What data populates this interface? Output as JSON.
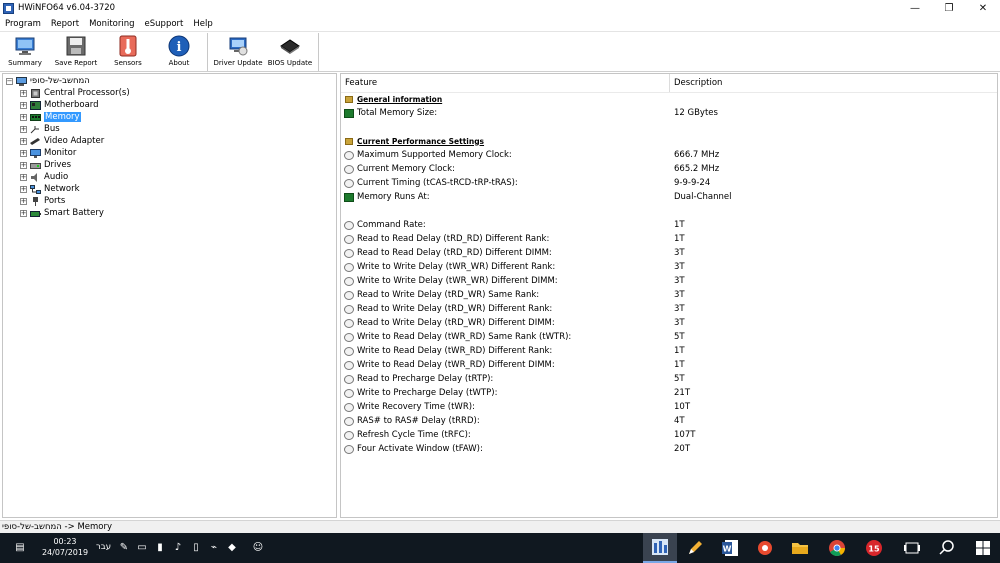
{
  "window": {
    "title": "HWiNFO64 v6.04-3720",
    "controls": [
      "—",
      "❐",
      "✕"
    ]
  },
  "menu": [
    "Program",
    "Report",
    "Monitoring",
    "eSupport",
    "Help"
  ],
  "toolbar": [
    {
      "label": "Summary",
      "icon": "monitor-icon"
    },
    {
      "label": "Save Report",
      "icon": "floppy-icon"
    },
    {
      "label": "Sensors",
      "icon": "thermometer-icon"
    },
    {
      "label": "About",
      "icon": "info-icon"
    },
    {
      "label": "Driver Update",
      "icon": "driver-update-icon"
    },
    {
      "label": "BIOS Update",
      "icon": "chip-icon"
    }
  ],
  "tree": {
    "root": "המחשב-של-סופי",
    "items": [
      {
        "label": "Central Processor(s)",
        "icon": "cpu-icon"
      },
      {
        "label": "Motherboard",
        "icon": "motherboard-icon"
      },
      {
        "label": "Memory",
        "icon": "memory-icon",
        "selected": true
      },
      {
        "label": "Bus",
        "icon": "bus-icon"
      },
      {
        "label": "Video Adapter",
        "icon": "video-adapter-icon"
      },
      {
        "label": "Monitor",
        "icon": "monitor-icon"
      },
      {
        "label": "Drives",
        "icon": "drive-icon"
      },
      {
        "label": "Audio",
        "icon": "audio-icon"
      },
      {
        "label": "Network",
        "icon": "network-icon"
      },
      {
        "label": "Ports",
        "icon": "ports-icon"
      },
      {
        "label": "Smart Battery",
        "icon": "battery-icon"
      }
    ]
  },
  "details": {
    "col_feature": "Feature",
    "col_description": "Description",
    "rows": [
      {
        "type": "section",
        "feature": "General information"
      },
      {
        "type": "chip",
        "feature": "Total Memory Size:",
        "value": "12 GBytes"
      },
      {
        "type": "blank"
      },
      {
        "type": "section",
        "feature": "Current Performance Settings"
      },
      {
        "type": "clock",
        "feature": "Maximum Supported Memory Clock:",
        "value": "666.7 MHz"
      },
      {
        "type": "clock",
        "feature": "Current Memory Clock:",
        "value": "665.2 MHz"
      },
      {
        "type": "clock",
        "feature": "Current Timing (tCAS-tRCD-tRP-tRAS):",
        "value": "9-9-9-24"
      },
      {
        "type": "chip",
        "feature": "Memory Runs At:",
        "value": "Dual-Channel"
      },
      {
        "type": "blank"
      },
      {
        "type": "clock",
        "feature": "Command Rate:",
        "value": "1T"
      },
      {
        "type": "clock",
        "feature": "Read to Read Delay (tRD_RD) Different Rank:",
        "value": "1T"
      },
      {
        "type": "clock",
        "feature": "Read to Read Delay (tRD_RD) Different DIMM:",
        "value": "3T"
      },
      {
        "type": "clock",
        "feature": "Write to Write Delay (tWR_WR) Different Rank:",
        "value": "3T"
      },
      {
        "type": "clock",
        "feature": "Write to Write Delay (tWR_WR) Different DIMM:",
        "value": "3T"
      },
      {
        "type": "clock",
        "feature": "Read to Write Delay (tRD_WR) Same Rank:",
        "value": "3T"
      },
      {
        "type": "clock",
        "feature": "Read to Write Delay (tRD_WR) Different Rank:",
        "value": "3T"
      },
      {
        "type": "clock",
        "feature": "Read to Write Delay (tRD_WR) Different DIMM:",
        "value": "3T"
      },
      {
        "type": "clock",
        "feature": "Write to Read Delay (tWR_RD) Same Rank (tWTR):",
        "value": "5T"
      },
      {
        "type": "clock",
        "feature": "Write to Read Delay (tWR_RD) Different Rank:",
        "value": "1T"
      },
      {
        "type": "clock",
        "feature": "Write to Read Delay (tWR_RD) Different DIMM:",
        "value": "1T"
      },
      {
        "type": "clock",
        "feature": "Read to Precharge Delay (tRTP):",
        "value": "5T"
      },
      {
        "type": "clock",
        "feature": "Write to Precharge Delay (tWTP):",
        "value": "21T"
      },
      {
        "type": "clock",
        "feature": "Write Recovery Time (tWR):",
        "value": "10T"
      },
      {
        "type": "clock",
        "feature": "RAS# to RAS# Delay (tRRD):",
        "value": "4T"
      },
      {
        "type": "clock",
        "feature": "Refresh Cycle Time (tRFC):",
        "value": "107T"
      },
      {
        "type": "clock",
        "feature": "Four Activate Window (tFAW):",
        "value": "20T"
      }
    ]
  },
  "status_bar": "המחשב-של-סופי -> Memory",
  "taskbar": {
    "time": "00:23",
    "date": "24/07/2019",
    "language": "עבר",
    "tray_icons": [
      "notification-icon",
      "network-icon",
      "volume-icon",
      "battery-icon",
      "usb-icon",
      "pen-icon",
      "shield-icon",
      "people-icon"
    ],
    "apps": [
      "hwinfo-icon",
      "pen-icon",
      "word-icon",
      "app-icon",
      "folder-icon",
      "chrome-icon",
      "app-red-icon",
      "task-view-icon",
      "search-icon",
      "start-icon"
    ]
  }
}
